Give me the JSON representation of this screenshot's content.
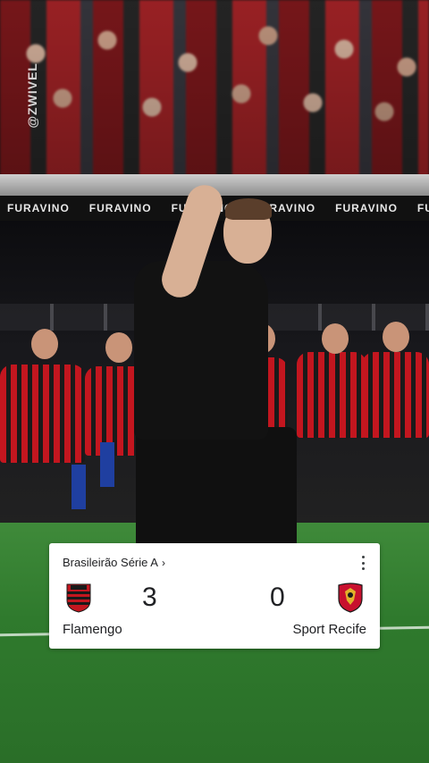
{
  "watermark": "@ZWIVEL",
  "banner": {
    "ads": [
      "FURAVINO",
      "FURAVINO",
      "FURAVINO",
      "FURAVINO",
      "FURAVINO",
      "FURAVINO"
    ]
  },
  "score_card": {
    "competition": "Brasileirão Série A",
    "chevron": "›",
    "home": {
      "team": "Flamengo",
      "score": "3",
      "crest_icon": "flamengo-crest-icon"
    },
    "away": {
      "team": "Sport Recife",
      "score": "0",
      "crest_icon": "sport-recife-crest-icon"
    }
  },
  "colors": {
    "flamengo_red": "#c3161f",
    "flamengo_black": "#1a1a1a",
    "sport_red": "#c8102e",
    "sport_gold": "#e2b12b",
    "card_bg": "#ffffff",
    "pitch": "#2f7a2d"
  }
}
